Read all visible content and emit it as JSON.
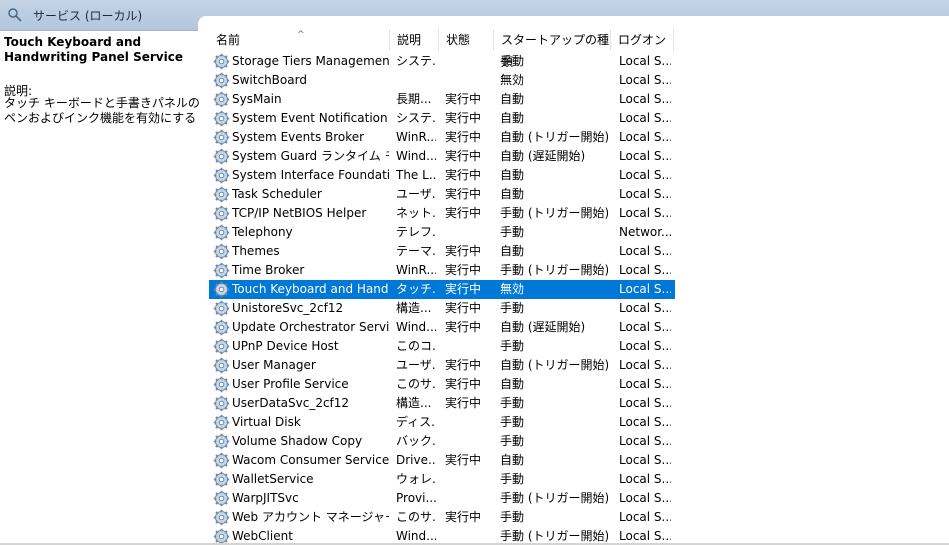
{
  "window": {
    "title": "サービス (ローカル)"
  },
  "detail": {
    "service_title": "Touch Keyboard and Handwriting Panel Service",
    "description_label": "説明:",
    "description": "タッチ キーボードと手書きパネルのペンおよびインク機能を有効にする"
  },
  "columns": {
    "name": "名前",
    "description": "説明",
    "status": "状態",
    "startup": "スタートアップの種類",
    "logon": "ログオン"
  },
  "rows": [
    {
      "name": "Storage Tiers Management",
      "desc": "システ...",
      "status": "",
      "startup": "手動",
      "logon": "Local S..."
    },
    {
      "name": "SwitchBoard",
      "desc": "",
      "status": "",
      "startup": "無効",
      "logon": "Local S..."
    },
    {
      "name": "SysMain",
      "desc": "長期...",
      "status": "実行中",
      "startup": "自動",
      "logon": "Local S..."
    },
    {
      "name": "System Event Notification S...",
      "desc": "システ...",
      "status": "実行中",
      "startup": "自動",
      "logon": "Local S..."
    },
    {
      "name": "System Events Broker",
      "desc": "WinR...",
      "status": "実行中",
      "startup": "自動 (トリガー開始)",
      "logon": "Local S..."
    },
    {
      "name": "System Guard ランタイム モニ...",
      "desc": "Wind...",
      "status": "実行中",
      "startup": "自動 (遅延開始)",
      "logon": "Local S..."
    },
    {
      "name": "System Interface Foundatio...",
      "desc": "The L...",
      "status": "実行中",
      "startup": "自動",
      "logon": "Local S..."
    },
    {
      "name": "Task Scheduler",
      "desc": "ユーザ...",
      "status": "実行中",
      "startup": "自動",
      "logon": "Local S..."
    },
    {
      "name": "TCP/IP NetBIOS Helper",
      "desc": "ネット...",
      "status": "実行中",
      "startup": "手動 (トリガー開始)",
      "logon": "Local S..."
    },
    {
      "name": "Telephony",
      "desc": "テレフ...",
      "status": "",
      "startup": "手動",
      "logon": "Networ..."
    },
    {
      "name": "Themes",
      "desc": "テーマ...",
      "status": "実行中",
      "startup": "自動",
      "logon": "Local S..."
    },
    {
      "name": "Time Broker",
      "desc": "WinR...",
      "status": "実行中",
      "startup": "手動 (トリガー開始)",
      "logon": "Local S..."
    },
    {
      "name": "Touch Keyboard and Hand...",
      "desc": "タッチ...",
      "status": "実行中",
      "startup": "無効",
      "logon": "Local S...",
      "selected": true
    },
    {
      "name": "UnistoreSvc_2cf12",
      "desc": "構造...",
      "status": "実行中",
      "startup": "手動",
      "logon": "Local S..."
    },
    {
      "name": "Update Orchestrator Service",
      "desc": "Wind...",
      "status": "実行中",
      "startup": "自動 (遅延開始)",
      "logon": "Local S..."
    },
    {
      "name": "UPnP Device Host",
      "desc": "このコ...",
      "status": "",
      "startup": "手動",
      "logon": "Local S..."
    },
    {
      "name": "User Manager",
      "desc": "ユーザ...",
      "status": "実行中",
      "startup": "自動 (トリガー開始)",
      "logon": "Local S..."
    },
    {
      "name": "User Profile Service",
      "desc": "このサ...",
      "status": "実行中",
      "startup": "自動",
      "logon": "Local S..."
    },
    {
      "name": "UserDataSvc_2cf12",
      "desc": "構造...",
      "status": "実行中",
      "startup": "手動",
      "logon": "Local S..."
    },
    {
      "name": "Virtual Disk",
      "desc": "ディス...",
      "status": "",
      "startup": "手動",
      "logon": "Local S..."
    },
    {
      "name": "Volume Shadow Copy",
      "desc": "バック...",
      "status": "",
      "startup": "手動",
      "logon": "Local S..."
    },
    {
      "name": "Wacom Consumer Service",
      "desc": "Drive...",
      "status": "実行中",
      "startup": "自動",
      "logon": "Local S..."
    },
    {
      "name": "WalletService",
      "desc": "ウォレ...",
      "status": "",
      "startup": "手動",
      "logon": "Local S..."
    },
    {
      "name": "WarpJITSvc",
      "desc": "Provi...",
      "status": "",
      "startup": "手動 (トリガー開始)",
      "logon": "Local S..."
    },
    {
      "name": "Web アカウント マネージャー",
      "desc": "このサ...",
      "status": "実行中",
      "startup": "手動",
      "logon": "Local S..."
    },
    {
      "name": "WebClient",
      "desc": "Wind...",
      "status": "",
      "startup": "手動 (トリガー開始)",
      "logon": "Local S..."
    }
  ],
  "icons": {
    "window": "services-search-icon",
    "row": "service-gear-icon",
    "sort": "sort-ascending-icon"
  },
  "colors": {
    "selection": "#0078d7",
    "titlebar": "#bccde2"
  }
}
